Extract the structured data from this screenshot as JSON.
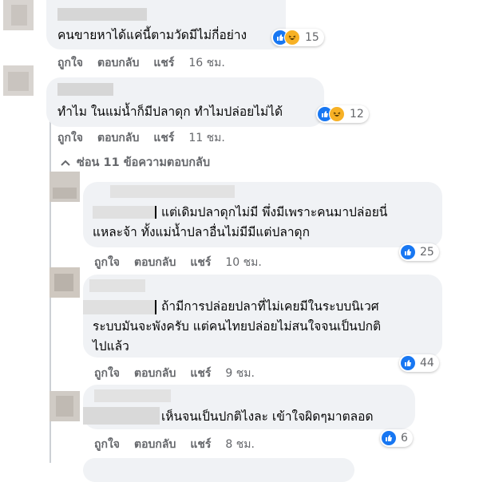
{
  "comments": [
    {
      "text_lines": [
        "คนขายหาได้แค่นี้ตามวัดมีไม่กี่อย่าง"
      ],
      "actions": {
        "like": "ถูกใจ",
        "reply": "ตอบกลับ",
        "share": "แชร์",
        "time": "16 ชม."
      },
      "reactions": {
        "types": [
          "like",
          "haha"
        ],
        "count": "15"
      }
    },
    {
      "text_lines": [
        "ทำไม ในแม่น้ำก็มีปลาดุก ทำไมปล่อยไม่ได้"
      ],
      "actions": {
        "like": "ถูกใจ",
        "reply": "ตอบกลับ",
        "share": "แชร์",
        "time": "11 ชม."
      },
      "reactions": {
        "types": [
          "like",
          "haha"
        ],
        "count": "12"
      }
    }
  ],
  "hide_replies_label": "ซ่อน 11 ข้อความตอบกลับ",
  "replies": [
    {
      "text_lines": [
        "แต่เดิมปลาดุกไม่มี พึ่งมีเพราะคนมาปล่อยนี่",
        "แหละจ้า ทั้งแม่น้ำปลาอื่นไม่มีมีแต่ปลาดุก"
      ],
      "actions": {
        "like": "ถูกใจ",
        "reply": "ตอบกลับ",
        "share": "แชร์",
        "time": "10 ชม."
      },
      "reactions": {
        "types": [
          "like"
        ],
        "count": "25"
      }
    },
    {
      "text_lines": [
        "ถ้ามีการปล่อยปลาที่ไม่เคยมีในระบบนิเวศ",
        "ระบบมันจะพังครับ แต่คนไทยปล่อยไม่สนใจจนเป็นปกติ",
        "ไปแล้ว"
      ],
      "actions": {
        "like": "ถูกใจ",
        "reply": "ตอบกลับ",
        "share": "แชร์",
        "time": "9 ชม."
      },
      "reactions": {
        "types": [
          "like"
        ],
        "count": "44"
      }
    },
    {
      "text_lines": [
        "เห็นจนเป็นปกติไงละ เข้าใจผิดๆมาตลอด"
      ],
      "actions": {
        "like": "ถูกใจ",
        "reply": "ตอบกลับ",
        "share": "แชร์",
        "time": "8 ชม."
      },
      "reactions": {
        "types": [
          "like"
        ],
        "count": "6"
      }
    }
  ],
  "colors": {
    "like_blue": "#1877f2",
    "haha_yellow": "#f7b125",
    "bubble": "#f0f2f5",
    "meta_gray": "#65676b"
  }
}
